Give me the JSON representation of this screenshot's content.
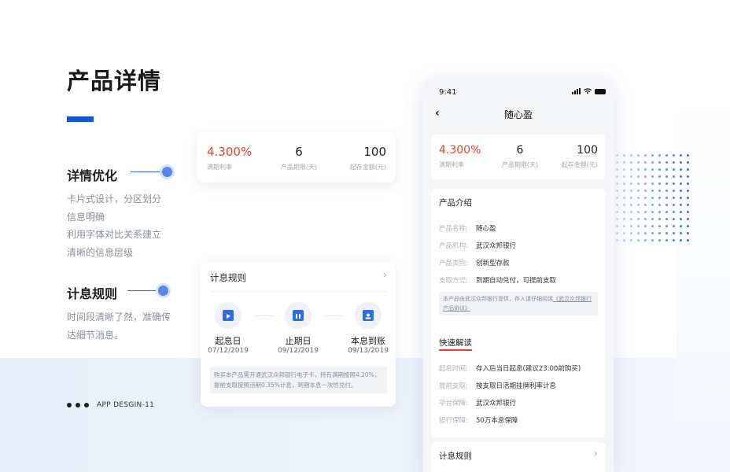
{
  "page": {
    "title": "产品详情",
    "footer_label": "APP DESGIN-11"
  },
  "sections": {
    "detail": {
      "title": "详情优化",
      "lines": [
        "卡片式设计，分区划分",
        "信息明确",
        "利用字体对比关系建立",
        "清晰的信息层级"
      ]
    },
    "interest": {
      "title": "计息规则",
      "lines": [
        "时间段清晰了然，准确传",
        "达细节消息。"
      ]
    }
  },
  "stats": [
    {
      "value": "4.300%",
      "label": "满期利率"
    },
    {
      "value": "6",
      "label": "产品期限(天)"
    },
    {
      "value": "100",
      "label": "起存金额(元)"
    }
  ],
  "rule_card": {
    "title": "计息规则",
    "steps": [
      {
        "label": "起息日",
        "date": "07/12/2019",
        "icon": "play-icon"
      },
      {
        "label": "止期日",
        "date": "09/12/2019",
        "icon": "pause-icon"
      },
      {
        "label": "本息到账",
        "date": "09/13/2019",
        "icon": "account-icon"
      }
    ],
    "note": "购买本产品需开通武汉众邦银行电子卡，持有满期按照4.20%，提前支取按照活期0.35%计息，到期本息一次性兑付。"
  },
  "phone": {
    "time": "9:41",
    "nav_title": "随心盈",
    "intro": {
      "title": "产品介绍",
      "rows": [
        {
          "k": "产品名称:",
          "v": "随心盈"
        },
        {
          "k": "产品机构:",
          "v": "武汉众邦银行"
        },
        {
          "k": "产品类别:",
          "v": "创新型存款"
        },
        {
          "k": "支取方式:",
          "v": "到期自动兑付，可提前支取"
        }
      ],
      "note_prefix": "本产品由武汉众邦银行提供，存入请仔细阅读",
      "note_link": "《武汉众邦银行产品协议》"
    },
    "quick": {
      "title": "快速解读",
      "rows": [
        {
          "k": "起息时间:",
          "v": "存入后当日起息(建议23:00前购买)"
        },
        {
          "k": "提前支取:",
          "v": "按支取日活期挂牌利率计息"
        },
        {
          "k": "平台保障:",
          "v": "武汉众邦银行"
        },
        {
          "k": "银行保障:",
          "v": "50万本息保障"
        }
      ]
    },
    "rule_title": "计息规则"
  },
  "colors": {
    "accent": "#1656d6",
    "rate_red": "#e8412c",
    "icon_blue": "#2f6ce0"
  }
}
